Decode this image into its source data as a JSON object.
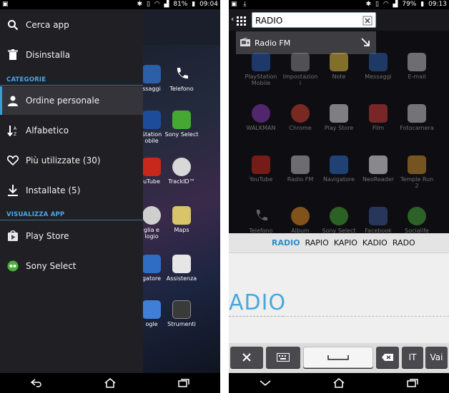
{
  "left": {
    "status": {
      "battery": "81%",
      "time": "09:04"
    },
    "drawer": {
      "search_label": "Cerca app",
      "uninstall_label": "Disinstalla",
      "categories_header": "CATEGORIE",
      "items": [
        {
          "label": "Ordine personale",
          "icon": "person-icon"
        },
        {
          "label": "Alfabetico",
          "icon": "sort-az-icon"
        },
        {
          "label": "Più utilizzate (30)",
          "icon": "heart-icon"
        },
        {
          "label": "Installate (5)",
          "icon": "download-icon"
        }
      ],
      "view_header": "VISUALIZZA APP",
      "view_items": [
        {
          "label": "Play Store",
          "icon": "play-store-icon"
        },
        {
          "label": "Sony Select",
          "icon": "sony-select-icon"
        }
      ]
    },
    "apps": {
      "col1": [
        "ssaggi",
        "Station\nobile",
        "uTube",
        "glia e\nlogio",
        "gatore",
        "ogle"
      ],
      "col2": [
        "Telefono",
        "Sony Select",
        "TrackID™",
        "Maps",
        "Assistenza",
        "Strumenti"
      ]
    }
  },
  "right": {
    "status": {
      "battery": "79%",
      "time": "09:13"
    },
    "search": {
      "value": "RADIO"
    },
    "suggestion": {
      "label": "Radio FM"
    },
    "grid": [
      [
        "PlayStation\nMobile",
        "Impostazion\ni",
        "Note",
        "Messaggi",
        "E-mail"
      ],
      [
        "WALKMAN",
        "Chrome",
        "Play Store",
        "Film",
        "Fotocamera"
      ],
      [
        "YouTube",
        "Radio FM",
        "Navigatore",
        "NeoReader",
        "Temple Run\n2"
      ],
      [
        "Telefono",
        "Album",
        "Sony Select",
        "Facebook",
        "Socialife"
      ]
    ],
    "keyboard": {
      "suggestions": [
        "RADIO",
        "RAPIO",
        "KAPIO",
        "KADIO",
        "RADO"
      ],
      "handwriting": "ADIO",
      "keys": {
        "lang": "IT",
        "go": "Vai"
      }
    }
  }
}
